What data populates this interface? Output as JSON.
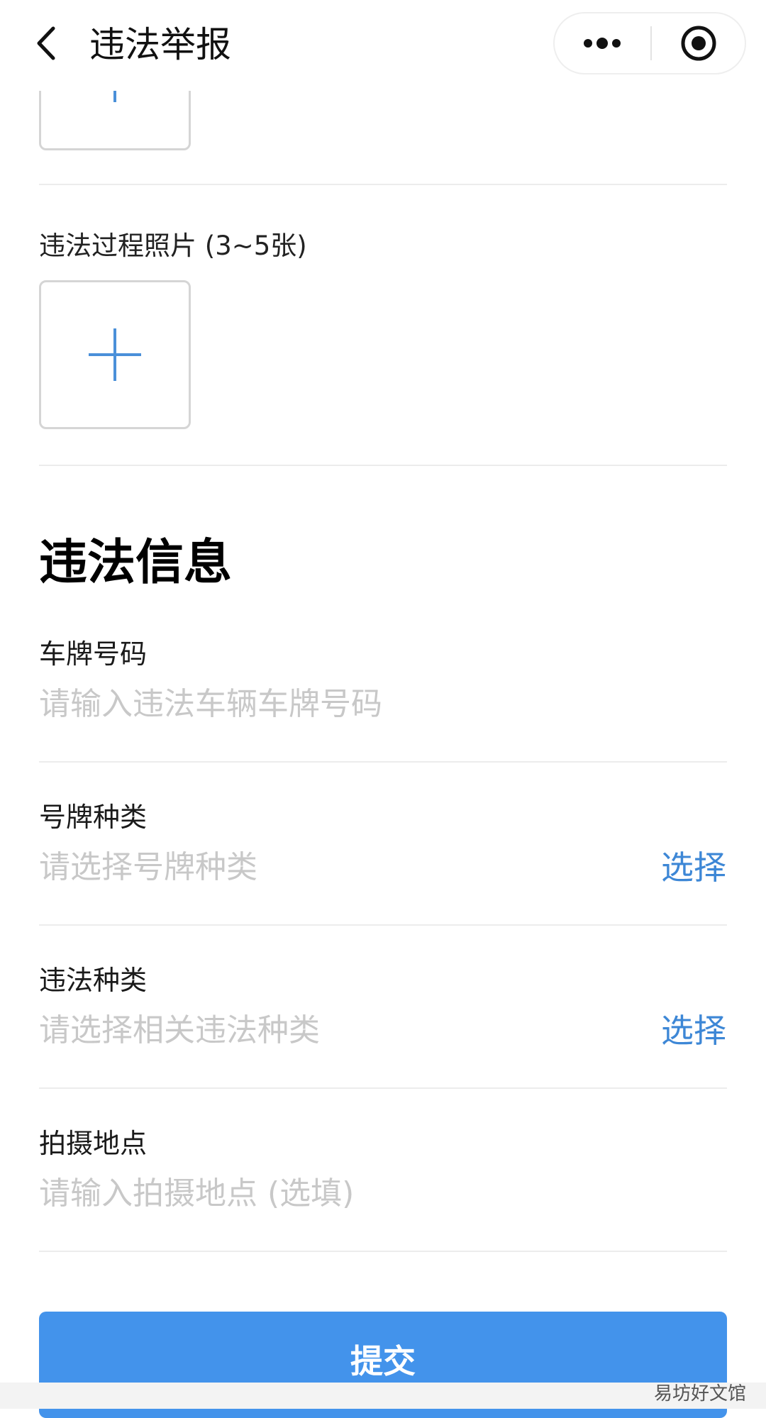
{
  "nav": {
    "title": "违法举报"
  },
  "sections": {
    "process_photos_label": "违法过程照片 (3~5张)",
    "info_title": "违法信息"
  },
  "fields": [
    {
      "label": "车牌号码",
      "placeholder": "请输入违法车辆车牌号码"
    },
    {
      "label": "号牌种类",
      "placeholder": "请选择号牌种类",
      "action": "选择"
    },
    {
      "label": "违法种类",
      "placeholder": "请选择相关违法种类",
      "action": "选择"
    },
    {
      "label": "拍摄地点",
      "placeholder": "请输入拍摄地点 (选填)"
    }
  ],
  "submit_label": "提交",
  "watermark": "易坊好文馆",
  "colors": {
    "accent": "#3d87d6",
    "submit_bg": "#4393eb",
    "placeholder": "#c8c8c8"
  },
  "icons": {
    "back": "chevron-left-icon",
    "more": "more-dots-icon",
    "close": "target-circle-icon",
    "add": "plus-icon"
  }
}
